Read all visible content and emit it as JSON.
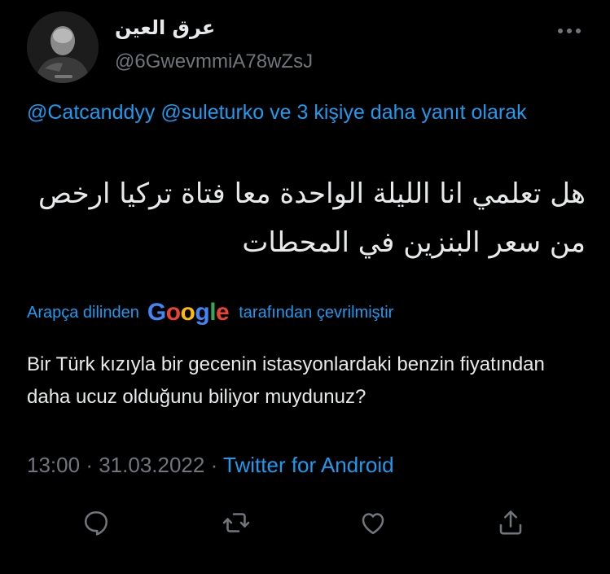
{
  "tweet": {
    "display_name": "عرق العين",
    "handle": "@6GwevmmiA78wZsJ",
    "reply_context": {
      "users": [
        "@Catcanddyy",
        "@suleturko"
      ],
      "suffix": "ve 3 kişiye daha yanıt olarak"
    },
    "text_arabic": "هل تعلمي انا الليلة الواحدة معا فتاة تركيا ارخص من سعر البنزين في المحطات",
    "translation_banner": {
      "before": "Arapça dilinden",
      "logo": "Google",
      "after": "tarafından çevrilmiştir"
    },
    "translation_text": "Bir Türk kızıyla bir gecenin istasyonlardaki benzin fiyatından daha ucuz olduğunu biliyor muydunuz?",
    "time": "13:00",
    "date": "31.03.2022",
    "separator": "·",
    "source": "Twitter for Android"
  },
  "icons": [
    "more-options-icon",
    "reply-icon",
    "retweet-icon",
    "like-icon",
    "share-icon"
  ],
  "colors": {
    "background": "#000000",
    "text": "#e7e9ea",
    "secondary": "#71767b",
    "accent": "#1d9bf0"
  }
}
